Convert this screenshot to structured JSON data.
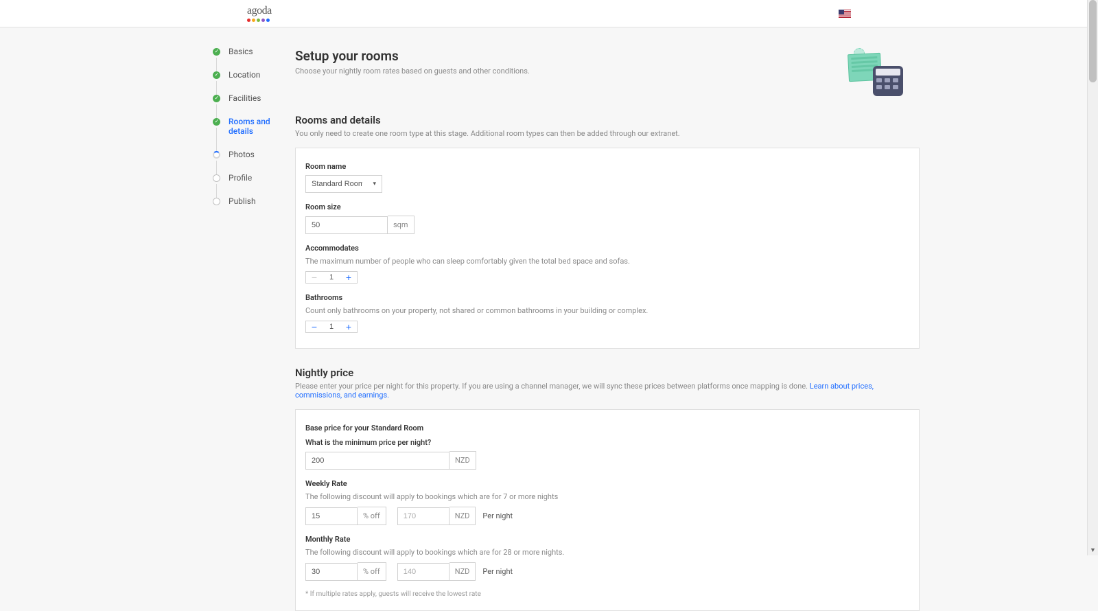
{
  "brand": {
    "name": "agoda",
    "dots": [
      "#e52e2e",
      "#f7a81b",
      "#7cbb3f",
      "#9058c7",
      "#1e6cff"
    ]
  },
  "sidebar": {
    "items": [
      {
        "label": "Basics",
        "state": "done"
      },
      {
        "label": "Location",
        "state": "done"
      },
      {
        "label": "Facilities",
        "state": "done"
      },
      {
        "label": "Rooms and details",
        "state": "done",
        "active": true
      },
      {
        "label": "Photos",
        "state": "loading"
      },
      {
        "label": "Profile",
        "state": "empty"
      },
      {
        "label": "Publish",
        "state": "empty"
      }
    ]
  },
  "hero": {
    "title": "Setup your rooms",
    "subtitle": "Choose your nightly room rates based on guests and other conditions."
  },
  "rooms": {
    "heading": "Rooms and details",
    "subtitle": "You only need to create one room type at this stage. Additional room types can then be added through our extranet.",
    "fields": {
      "room_name_label": "Room name",
      "room_name_value": "Standard Room",
      "room_size_label": "Room size",
      "room_size_value": "50",
      "room_size_unit": "sqm",
      "accommodates_label": "Accommodates",
      "accommodates_help": "The maximum number of people who can sleep comfortably given the total bed space and sofas.",
      "accommodates_value": "1",
      "bathrooms_label": "Bathrooms",
      "bathrooms_help": "Count only bathrooms on your property, not shared or common bathrooms in your building or complex.",
      "bathrooms_value": "1"
    }
  },
  "pricing": {
    "heading": "Nightly price",
    "subtitle_a": "Please enter your price per night for this property. If you are using a channel manager, we will sync these prices between platforms once mapping is done. ",
    "subtitle_link": "Learn about prices, commissions, and earnings.",
    "base_title": "Base price for your Standard Room",
    "min_price_label": "What is the minimum price per night?",
    "min_price_value": "200",
    "currency": "NZD",
    "weekly_label": "Weekly Rate",
    "weekly_help": "The following discount will apply to bookings which are for 7 or more nights",
    "weekly_pct": "15",
    "pct_unit": "% off",
    "weekly_calc": "170",
    "per_night": "Per night",
    "monthly_label": "Monthly Rate",
    "monthly_help": "The following discount will apply to bookings which are for 28 or more nights.",
    "monthly_pct": "30",
    "monthly_calc": "140",
    "footnote": "* If multiple rates apply, guests will receive the lowest rate"
  }
}
